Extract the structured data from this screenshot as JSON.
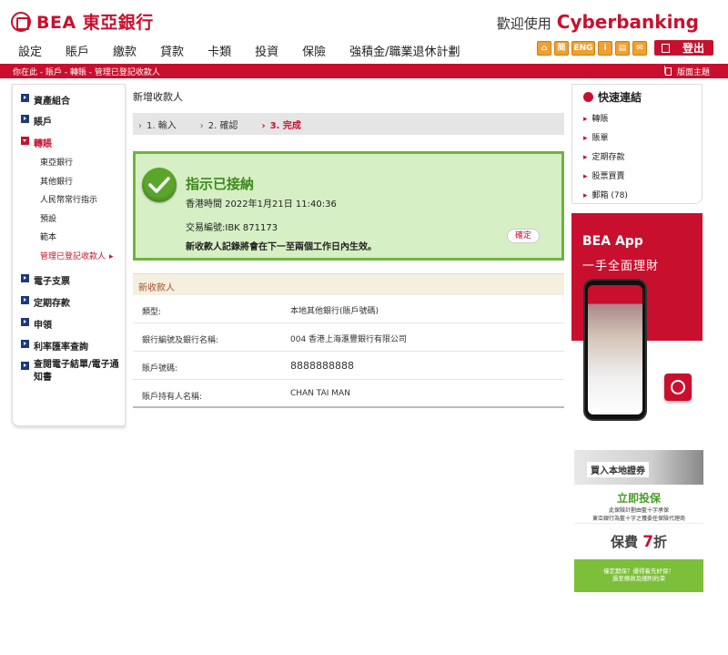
{
  "brand": {
    "logo_text": "BEA 東亞銀行",
    "welcome": "歡迎使用",
    "cyber": "Cyberbanking"
  },
  "nav": [
    "設定",
    "賬戶",
    "繳款",
    "貸款",
    "卡類",
    "投資",
    "保險",
    "強積金/職業退休計劃"
  ],
  "tools": {
    "eng": "ENG",
    "logout": "登出"
  },
  "crumbbar": {
    "crumb": "你在此 - 賬戶 - 轉賬 - 管理已登記收款人",
    "separator": "|",
    "theme": "版面主題"
  },
  "sidebar": {
    "items": [
      {
        "label": "資產組合"
      },
      {
        "label": "賬戶"
      },
      {
        "label": "轉賬"
      },
      {
        "label": "電子支票"
      },
      {
        "label": "定期存款"
      },
      {
        "label": "申領"
      },
      {
        "label": "利率匯率查詢"
      },
      {
        "label": "查閱電子結單/電子通知書"
      }
    ],
    "sub_items": [
      "東亞銀行",
      "其他銀行",
      "人民幣常行指示",
      "預設",
      "範本",
      "管理已登記收款人"
    ]
  },
  "main": {
    "title": "新增收款人",
    "steps": [
      "1. 輸入",
      "2. 確認",
      "3. 完成"
    ],
    "success": {
      "title": "指示已接納",
      "time": "香港時間 2022年1月21日 11:40:36",
      "ref": "交易編號:IBK 871173",
      "note": "新收款人記錄將會在下一至兩個工作日內生效。",
      "confirm": "確定"
    },
    "detail": {
      "heading": "新收款人",
      "rows": [
        {
          "label": "類型:",
          "value": "本地其他銀行(賬戶號碼)"
        },
        {
          "label": "銀行編號及銀行名稱:",
          "value": "004 香港上海滙豐銀行有限公司"
        },
        {
          "label": "賬戶號碼:",
          "value": "8888888888"
        },
        {
          "label": "賬戶持有人名稱:",
          "value": "CHAN TAI MAN"
        }
      ]
    }
  },
  "quick": {
    "title": "快速連結",
    "items": [
      "轉賬",
      "賬單",
      "定期存款",
      "股票買賣",
      "郵箱 (78)"
    ]
  },
  "promo": {
    "title": "BEA App",
    "subtitle": "一手全面理財"
  },
  "insurance": {
    "top": "買入本地證券",
    "buy": "立即投保",
    "small1": "此保險計劃由藍十字承保",
    "small2": "東亞銀行為藍十字之獲委任保險代理商",
    "price_pre": "保費",
    "price_num": "7",
    "price_post": "折",
    "green1": "僅定期保？優得着先好保！",
    "green2": "過至條款及細則約束"
  },
  "colors": {
    "brand_red": "#c8102e",
    "success_green": "#6fb33e",
    "nav_blue": "#1a3a7a"
  }
}
